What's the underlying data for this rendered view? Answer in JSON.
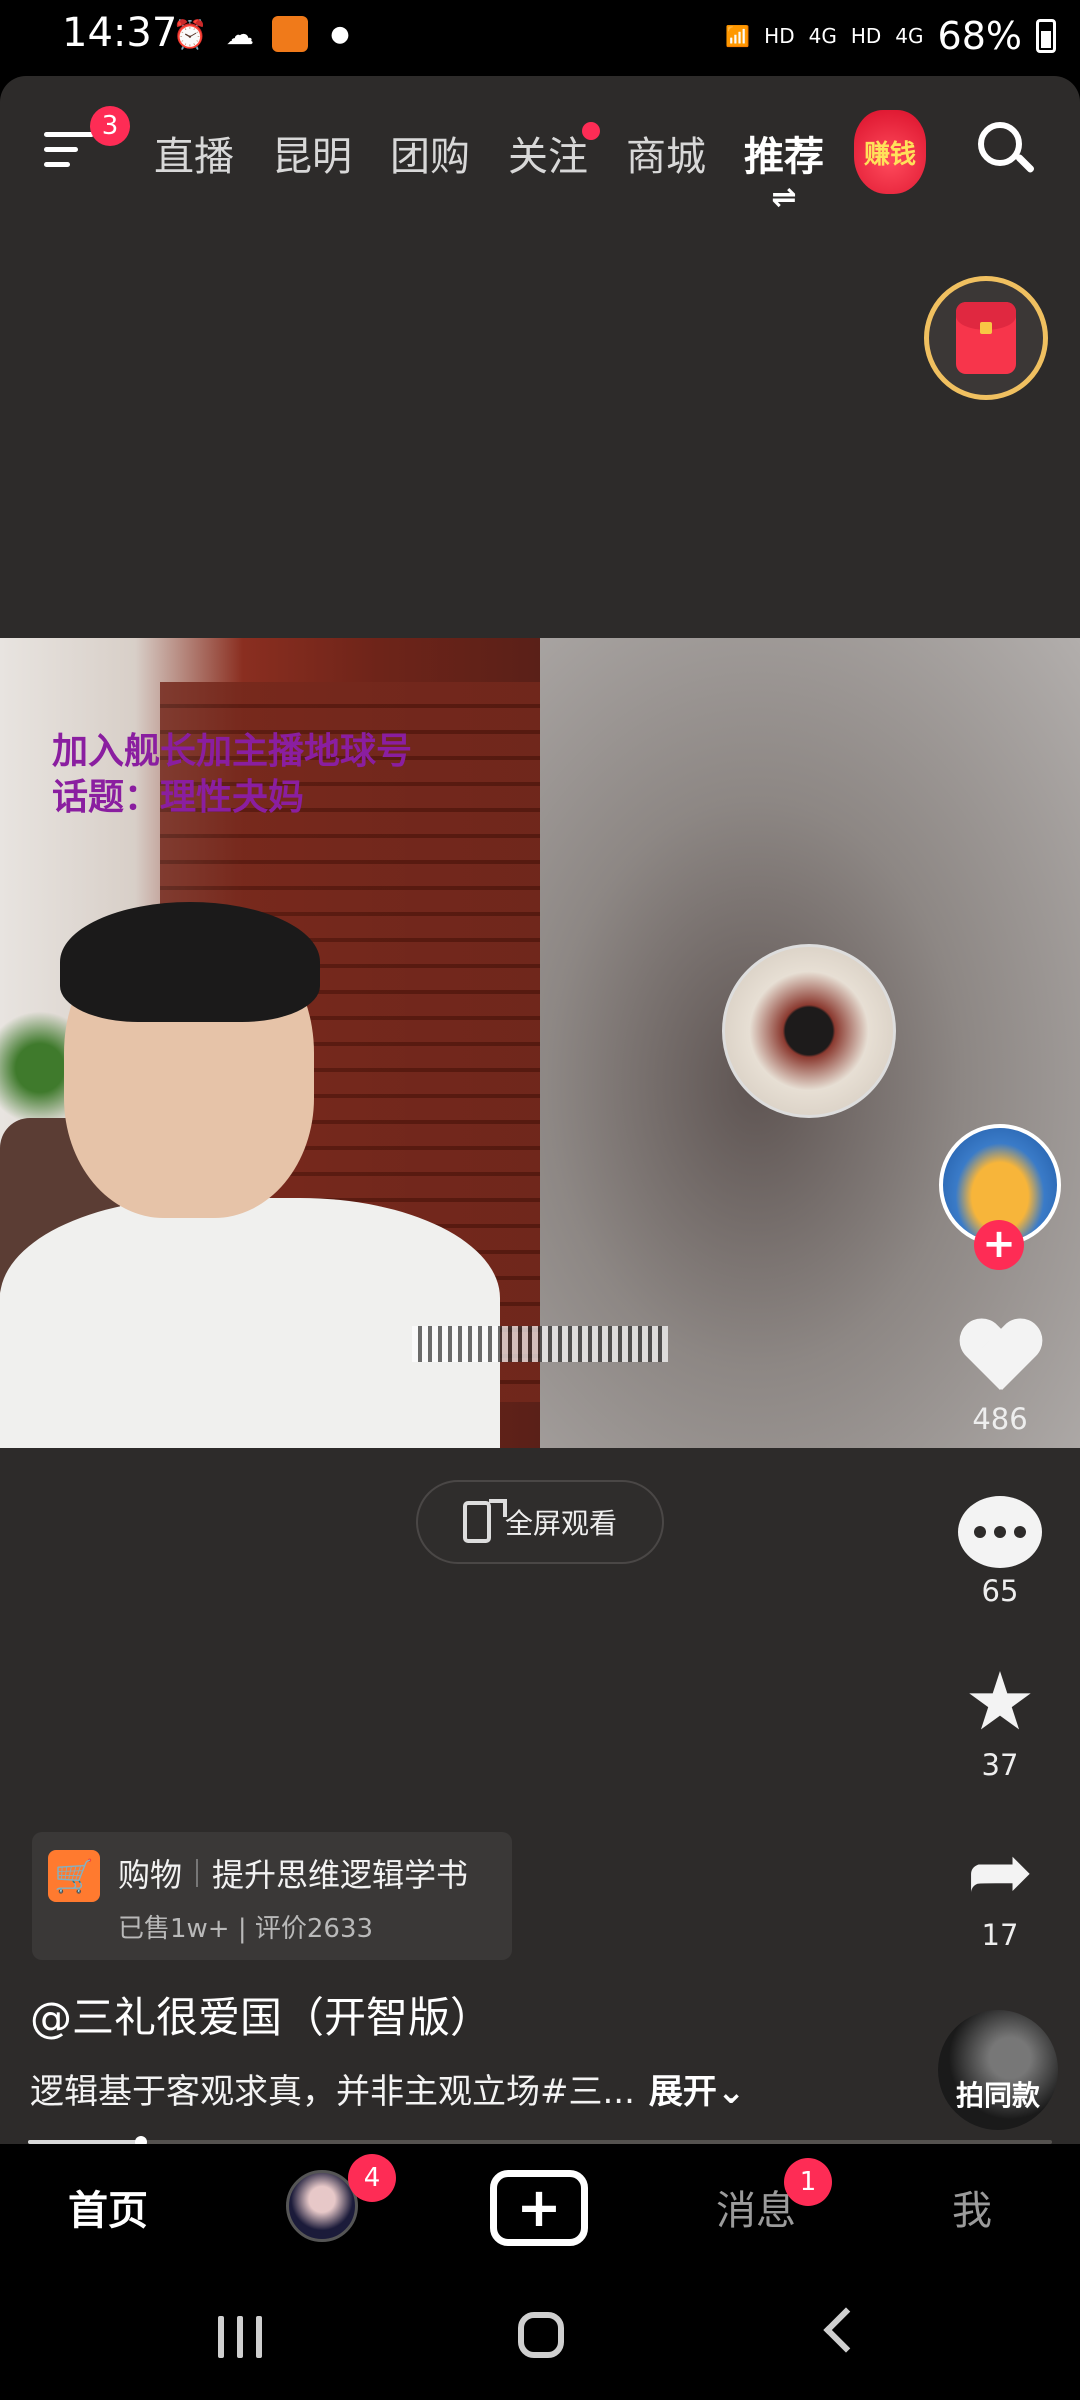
{
  "status_bar": {
    "time": "14:37",
    "signal_labels": [
      "HD",
      "4G",
      "HD",
      "4G"
    ],
    "battery": "68%"
  },
  "top_nav": {
    "menu_badge": "3",
    "tabs": [
      {
        "label": "直播"
      },
      {
        "label": "昆明"
      },
      {
        "label": "团购"
      },
      {
        "label": "关注"
      },
      {
        "label": "商城"
      },
      {
        "label": "推荐"
      }
    ],
    "earn_label": "赚钱",
    "active_tab": "推荐"
  },
  "video": {
    "overlay_line1": "加入舰长加主播地球号",
    "overlay_line2": "话题：理性夬妈"
  },
  "fullscreen_label": "全屏观看",
  "actions": {
    "likes": "486",
    "comments": "65",
    "favorites": "37",
    "shares": "17",
    "same_style": "拍同款"
  },
  "product": {
    "tag": "购物",
    "title": "提升思维逻辑学书",
    "meta": "已售1w+ | 评价2633"
  },
  "post": {
    "author": "@三礼很爱国（开智版）",
    "description": "逻辑基于客观求真，并非主观立场#三...",
    "expand": "展开⌄"
  },
  "progress": 0.11,
  "bottom_tabs": {
    "home": "首页",
    "friends_badge": "4",
    "create": "+",
    "messages": "消息",
    "messages_badge": "1",
    "me": "我"
  },
  "colors": {
    "accent": "#fe2c55",
    "background": "#2d2b2a",
    "cart": "#ff7a2f"
  },
  "icons": [
    "menu-icon",
    "search-icon",
    "red-packet-icon",
    "heart-icon",
    "comment-icon",
    "star-icon",
    "share-icon",
    "cart-icon",
    "plus-icon"
  ]
}
